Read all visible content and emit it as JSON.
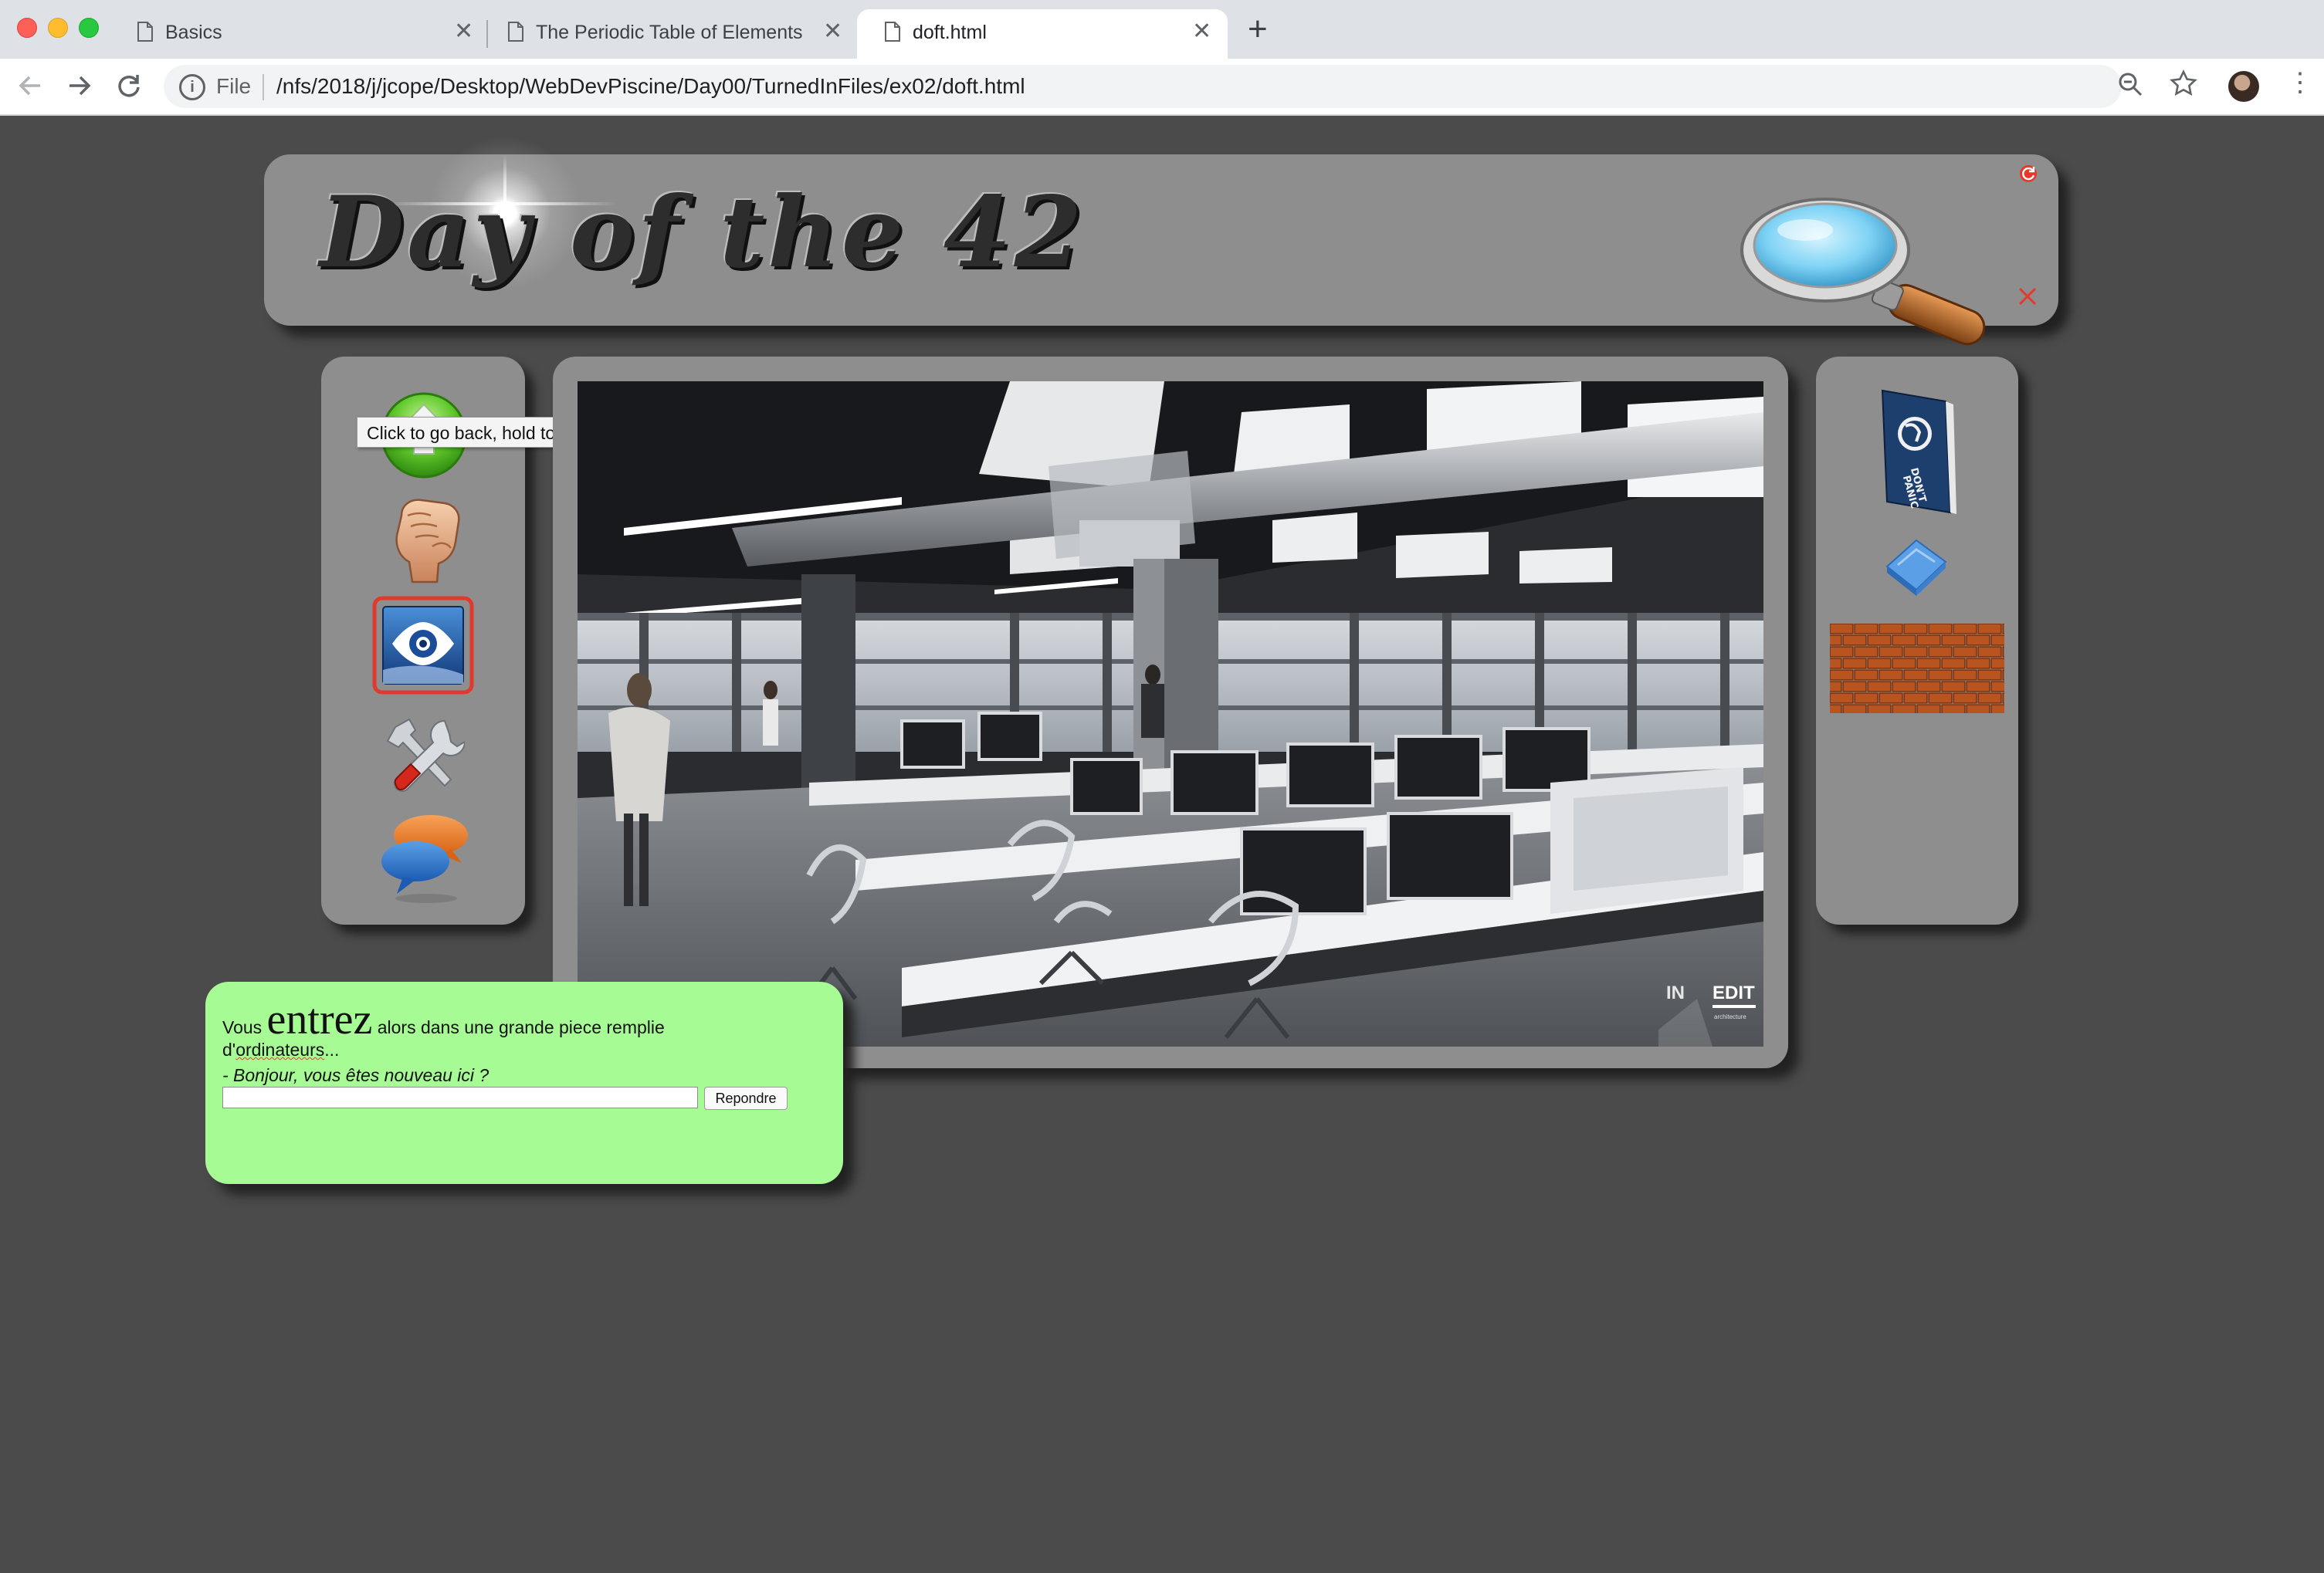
{
  "browser": {
    "tabs": [
      {
        "title": "Basics",
        "icon": "document-icon"
      },
      {
        "title": "The Periodic Table of Elements",
        "icon": "document-icon"
      },
      {
        "title": "doft.html",
        "icon": "document-icon",
        "active": true
      }
    ],
    "new_tab_label": "+",
    "close_label": "✕",
    "address": {
      "scheme": "File",
      "url": "/nfs/2018/j/jcope/Desktop/WebDevPiscine/Day00/TurnedInFiles/ex02/doft.html"
    }
  },
  "page": {
    "title": "Day of the 42",
    "tooltip": "Click to go back, hold to see history",
    "nav_icons": [
      "up-arrow-icon",
      "fist-icon",
      "eye-icon",
      "tools-icon",
      "chat-icon"
    ],
    "selected_nav": "eye-icon",
    "inventory_icons": [
      "book-icon",
      "towel-icon",
      "brick-icon"
    ],
    "book_text": [
      "DON'T",
      "PANIC"
    ],
    "scene_watermark": {
      "left": "IN",
      "right": "EDIT",
      "sub": "architecture"
    },
    "dialog": {
      "before": "Vous",
      "emphasis": "entrez",
      "middle": "alors dans une grande piece remplie",
      "line2_prefix": "d'",
      "line2_word": "ordinateurs",
      "line2_suffix": "...",
      "quote": "- Bonjour, vous êtes nouveau ici ?",
      "input_value": "",
      "button_label": "Repondre"
    },
    "colors": {
      "background": "#4b4b4b",
      "panel": "#8e8e8e",
      "dialog": "#a7fb94",
      "selection": "#e03a2e"
    }
  }
}
